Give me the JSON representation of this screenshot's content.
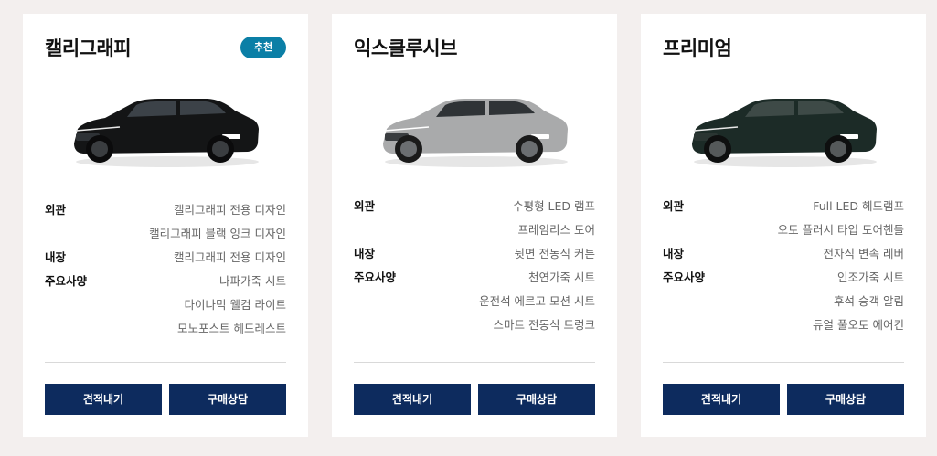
{
  "cards": [
    {
      "title": "캘리그래피",
      "badge": "추천",
      "car_color": "#141516",
      "specs": [
        {
          "label": "외관",
          "value": "캘리그래피 전용 디자인"
        },
        {
          "label": "",
          "value": "캘리그래피 블랙 잉크 디자인"
        },
        {
          "label": "내장",
          "value": "캘리그래피 전용 디자인"
        },
        {
          "label": "주요사양",
          "value": "나파가죽 시트"
        },
        {
          "label": "",
          "value": "다이나믹 웰컴 라이트"
        },
        {
          "label": "",
          "value": "모노포스트 헤드레스트"
        }
      ],
      "buttons": {
        "quote": "견적내기",
        "consult": "구매상담"
      }
    },
    {
      "title": "익스클루시브",
      "badge": "",
      "car_color": "#a9aaab",
      "specs": [
        {
          "label": "외관",
          "value": "수평형 LED 램프"
        },
        {
          "label": "",
          "value": "프레임리스 도어"
        },
        {
          "label": "내장",
          "value": "뒷면 전동식 커튼"
        },
        {
          "label": "주요사양",
          "value": "천연가죽 시트"
        },
        {
          "label": "",
          "value": "운전석 에르고 모션 시트"
        },
        {
          "label": "",
          "value": "스마트 전동식 트렁크"
        }
      ],
      "buttons": {
        "quote": "견적내기",
        "consult": "구매상담"
      }
    },
    {
      "title": "프리미엄",
      "badge": "",
      "car_color": "#1c2b27",
      "specs": [
        {
          "label": "외관",
          "value": "Full LED 헤드램프"
        },
        {
          "label": "",
          "value": "오토 플러시 타입 도어핸들"
        },
        {
          "label": "내장",
          "value": "전자식 변속 레버"
        },
        {
          "label": "주요사양",
          "value": "인조가죽 시트"
        },
        {
          "label": "",
          "value": "후석 승객 알림"
        },
        {
          "label": "",
          "value": "듀얼 풀오토 에어컨"
        }
      ],
      "buttons": {
        "quote": "견적내기",
        "consult": "구매상담"
      }
    }
  ]
}
